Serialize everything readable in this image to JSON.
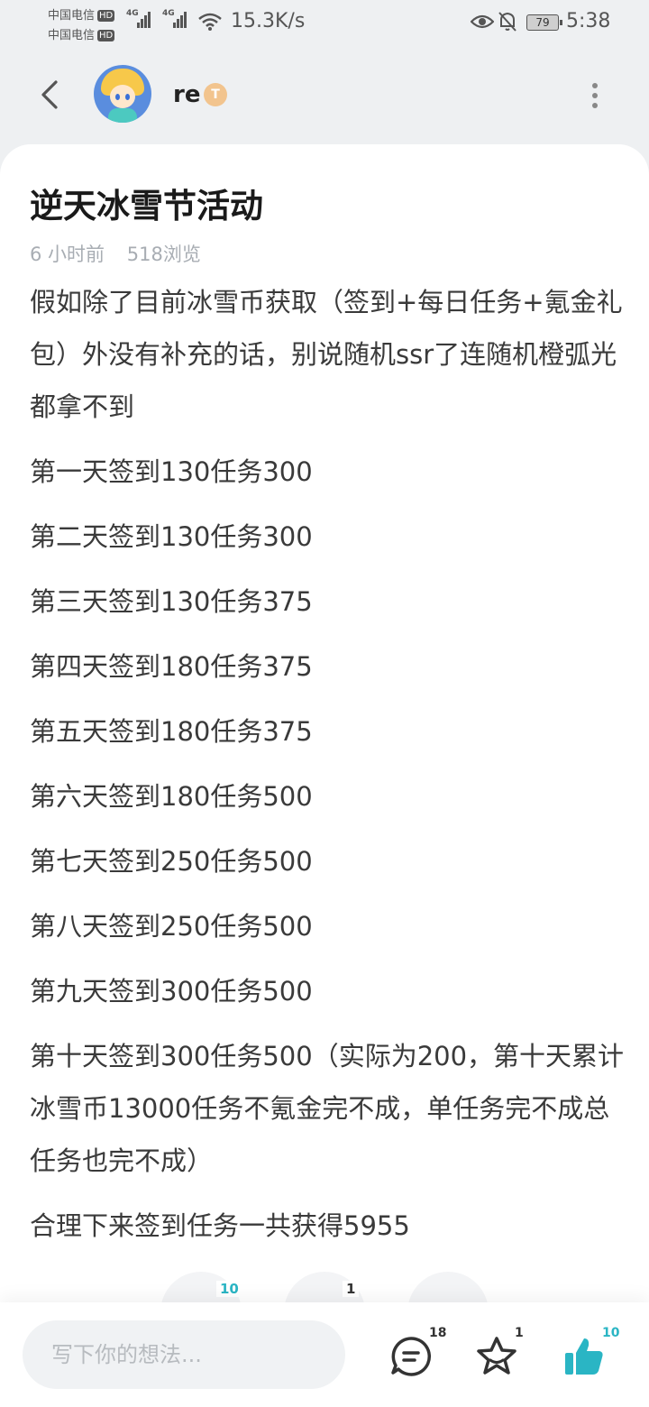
{
  "status_bar": {
    "carrier1": "中国电信",
    "carrier2": "中国电信",
    "hd": "HD",
    "network": "4G",
    "speed": "15.3K/s",
    "battery": "79",
    "time": "5:38"
  },
  "header": {
    "username": "re",
    "badge": "T"
  },
  "post": {
    "title": "逆天冰雪节活动",
    "time_ago": "6 小时前",
    "views": "518浏览",
    "paragraphs": [
      "假如除了目前冰雪币获取（签到+每日任务+氪金礼包）外没有补充的话，别说随机ssr了连随机橙弧光都拿不到",
      "第一天签到130任务300",
      "第二天签到130任务300",
      "第三天签到130任务375",
      "第四天签到180任务375",
      "第五天签到180任务375",
      "第六天签到180任务500",
      "第七天签到250任务500",
      "第八天签到250任务500",
      "第九天签到300任务500",
      "第十天签到300任务500（实际为200，第十天累计冰雪币13000任务不氪金完不成，单任务完不成总任务也完不成）",
      "合理下来签到任务一共获得5955"
    ]
  },
  "faded_reactions": {
    "like_count": "10",
    "favorite_count": "1"
  },
  "bottom_bar": {
    "comment_placeholder": "写下你的想法...",
    "comment_count": "18",
    "favorite_count": "1",
    "like_count": "10",
    "accent_color": "#2ab5c4"
  }
}
